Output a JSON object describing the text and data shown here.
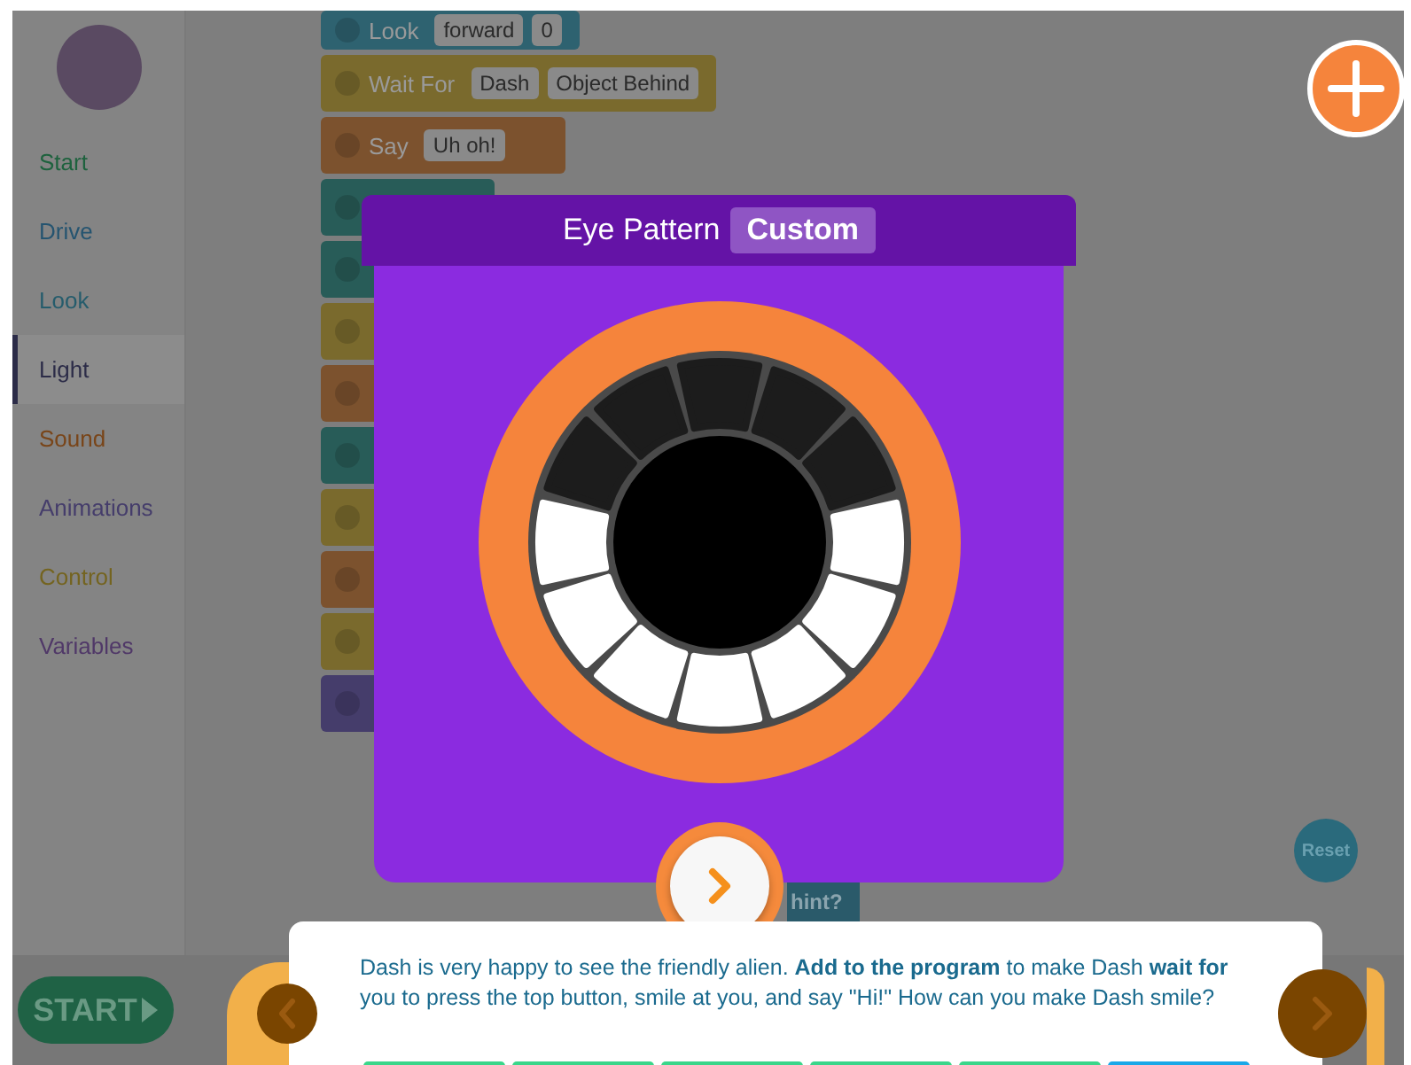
{
  "sidebar": {
    "items": [
      {
        "label": "Start",
        "color": "#1e623e",
        "selected": false
      },
      {
        "label": "Drive",
        "color": "#255470",
        "selected": false
      },
      {
        "label": "Look",
        "color": "#255c6c",
        "selected": false
      },
      {
        "label": "Light",
        "color": "#2c2c48",
        "selected": true
      },
      {
        "label": "Sound",
        "color": "#794519",
        "selected": false
      },
      {
        "label": "Animations",
        "color": "#453d6b",
        "selected": false
      },
      {
        "label": "Control",
        "color": "#746420",
        "selected": false
      },
      {
        "label": "Variables",
        "color": "#503868",
        "selected": false
      }
    ]
  },
  "blocks": [
    {
      "color": "#2e6270",
      "label": "Look",
      "params": [
        "forward",
        "0"
      ]
    },
    {
      "color": "#7a6a2d",
      "label": "Wait For",
      "params": [
        "Dash",
        "Object Behind"
      ]
    },
    {
      "color": "#7c522e",
      "label": "Say",
      "params": [
        "Uh oh!"
      ]
    },
    {
      "color": "#285c58"
    },
    {
      "color": "#285c58"
    },
    {
      "color": "#7a6a2d"
    },
    {
      "color": "#7c522e"
    },
    {
      "color": "#285c58"
    },
    {
      "color": "#7a6a2d"
    },
    {
      "color": "#7c522e"
    },
    {
      "color": "#7a6a2d"
    },
    {
      "color": "#453d6b"
    }
  ],
  "start_button": "START",
  "hint_button": "hint?",
  "reset_button": "Reset",
  "modal": {
    "title": "Eye Pattern",
    "mode": "Custom",
    "segments": [
      {
        "on": false
      },
      {
        "on": false
      },
      {
        "on": false
      },
      {
        "on": true
      },
      {
        "on": true
      },
      {
        "on": true
      },
      {
        "on": true
      },
      {
        "on": true
      },
      {
        "on": true
      },
      {
        "on": true
      },
      {
        "on": false
      },
      {
        "on": false
      }
    ]
  },
  "instruction": "Dash is very happy to see the friendly alien. **Add to the program** to make Dash **wait for** you to press the top button, smile at you, and say \"Hi!\" How can you make Dash smile?",
  "progress": [
    {
      "current": false
    },
    {
      "current": false
    },
    {
      "current": false
    },
    {
      "current": false
    },
    {
      "current": false
    },
    {
      "current": true
    }
  ]
}
